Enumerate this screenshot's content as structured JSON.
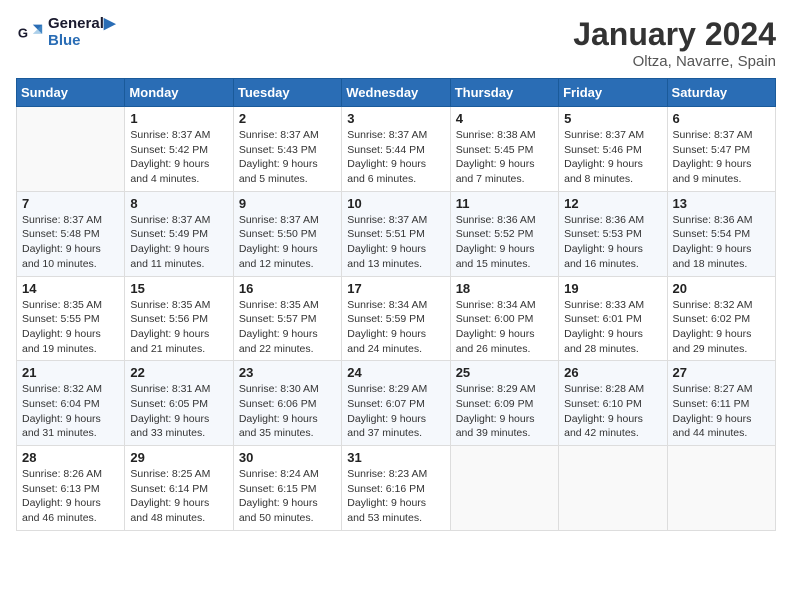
{
  "header": {
    "logo_line1": "General",
    "logo_line2": "Blue",
    "month": "January 2024",
    "location": "Oltza, Navarre, Spain"
  },
  "weekdays": [
    "Sunday",
    "Monday",
    "Tuesday",
    "Wednesday",
    "Thursday",
    "Friday",
    "Saturday"
  ],
  "weeks": [
    [
      {
        "day": "",
        "info": ""
      },
      {
        "day": "1",
        "info": "Sunrise: 8:37 AM\nSunset: 5:42 PM\nDaylight: 9 hours\nand 4 minutes."
      },
      {
        "day": "2",
        "info": "Sunrise: 8:37 AM\nSunset: 5:43 PM\nDaylight: 9 hours\nand 5 minutes."
      },
      {
        "day": "3",
        "info": "Sunrise: 8:37 AM\nSunset: 5:44 PM\nDaylight: 9 hours\nand 6 minutes."
      },
      {
        "day": "4",
        "info": "Sunrise: 8:38 AM\nSunset: 5:45 PM\nDaylight: 9 hours\nand 7 minutes."
      },
      {
        "day": "5",
        "info": "Sunrise: 8:37 AM\nSunset: 5:46 PM\nDaylight: 9 hours\nand 8 minutes."
      },
      {
        "day": "6",
        "info": "Sunrise: 8:37 AM\nSunset: 5:47 PM\nDaylight: 9 hours\nand 9 minutes."
      }
    ],
    [
      {
        "day": "7",
        "info": "Sunrise: 8:37 AM\nSunset: 5:48 PM\nDaylight: 9 hours\nand 10 minutes."
      },
      {
        "day": "8",
        "info": "Sunrise: 8:37 AM\nSunset: 5:49 PM\nDaylight: 9 hours\nand 11 minutes."
      },
      {
        "day": "9",
        "info": "Sunrise: 8:37 AM\nSunset: 5:50 PM\nDaylight: 9 hours\nand 12 minutes."
      },
      {
        "day": "10",
        "info": "Sunrise: 8:37 AM\nSunset: 5:51 PM\nDaylight: 9 hours\nand 13 minutes."
      },
      {
        "day": "11",
        "info": "Sunrise: 8:36 AM\nSunset: 5:52 PM\nDaylight: 9 hours\nand 15 minutes."
      },
      {
        "day": "12",
        "info": "Sunrise: 8:36 AM\nSunset: 5:53 PM\nDaylight: 9 hours\nand 16 minutes."
      },
      {
        "day": "13",
        "info": "Sunrise: 8:36 AM\nSunset: 5:54 PM\nDaylight: 9 hours\nand 18 minutes."
      }
    ],
    [
      {
        "day": "14",
        "info": "Sunrise: 8:35 AM\nSunset: 5:55 PM\nDaylight: 9 hours\nand 19 minutes."
      },
      {
        "day": "15",
        "info": "Sunrise: 8:35 AM\nSunset: 5:56 PM\nDaylight: 9 hours\nand 21 minutes."
      },
      {
        "day": "16",
        "info": "Sunrise: 8:35 AM\nSunset: 5:57 PM\nDaylight: 9 hours\nand 22 minutes."
      },
      {
        "day": "17",
        "info": "Sunrise: 8:34 AM\nSunset: 5:59 PM\nDaylight: 9 hours\nand 24 minutes."
      },
      {
        "day": "18",
        "info": "Sunrise: 8:34 AM\nSunset: 6:00 PM\nDaylight: 9 hours\nand 26 minutes."
      },
      {
        "day": "19",
        "info": "Sunrise: 8:33 AM\nSunset: 6:01 PM\nDaylight: 9 hours\nand 28 minutes."
      },
      {
        "day": "20",
        "info": "Sunrise: 8:32 AM\nSunset: 6:02 PM\nDaylight: 9 hours\nand 29 minutes."
      }
    ],
    [
      {
        "day": "21",
        "info": "Sunrise: 8:32 AM\nSunset: 6:04 PM\nDaylight: 9 hours\nand 31 minutes."
      },
      {
        "day": "22",
        "info": "Sunrise: 8:31 AM\nSunset: 6:05 PM\nDaylight: 9 hours\nand 33 minutes."
      },
      {
        "day": "23",
        "info": "Sunrise: 8:30 AM\nSunset: 6:06 PM\nDaylight: 9 hours\nand 35 minutes."
      },
      {
        "day": "24",
        "info": "Sunrise: 8:29 AM\nSunset: 6:07 PM\nDaylight: 9 hours\nand 37 minutes."
      },
      {
        "day": "25",
        "info": "Sunrise: 8:29 AM\nSunset: 6:09 PM\nDaylight: 9 hours\nand 39 minutes."
      },
      {
        "day": "26",
        "info": "Sunrise: 8:28 AM\nSunset: 6:10 PM\nDaylight: 9 hours\nand 42 minutes."
      },
      {
        "day": "27",
        "info": "Sunrise: 8:27 AM\nSunset: 6:11 PM\nDaylight: 9 hours\nand 44 minutes."
      }
    ],
    [
      {
        "day": "28",
        "info": "Sunrise: 8:26 AM\nSunset: 6:13 PM\nDaylight: 9 hours\nand 46 minutes."
      },
      {
        "day": "29",
        "info": "Sunrise: 8:25 AM\nSunset: 6:14 PM\nDaylight: 9 hours\nand 48 minutes."
      },
      {
        "day": "30",
        "info": "Sunrise: 8:24 AM\nSunset: 6:15 PM\nDaylight: 9 hours\nand 50 minutes."
      },
      {
        "day": "31",
        "info": "Sunrise: 8:23 AM\nSunset: 6:16 PM\nDaylight: 9 hours\nand 53 minutes."
      },
      {
        "day": "",
        "info": ""
      },
      {
        "day": "",
        "info": ""
      },
      {
        "day": "",
        "info": ""
      }
    ]
  ]
}
